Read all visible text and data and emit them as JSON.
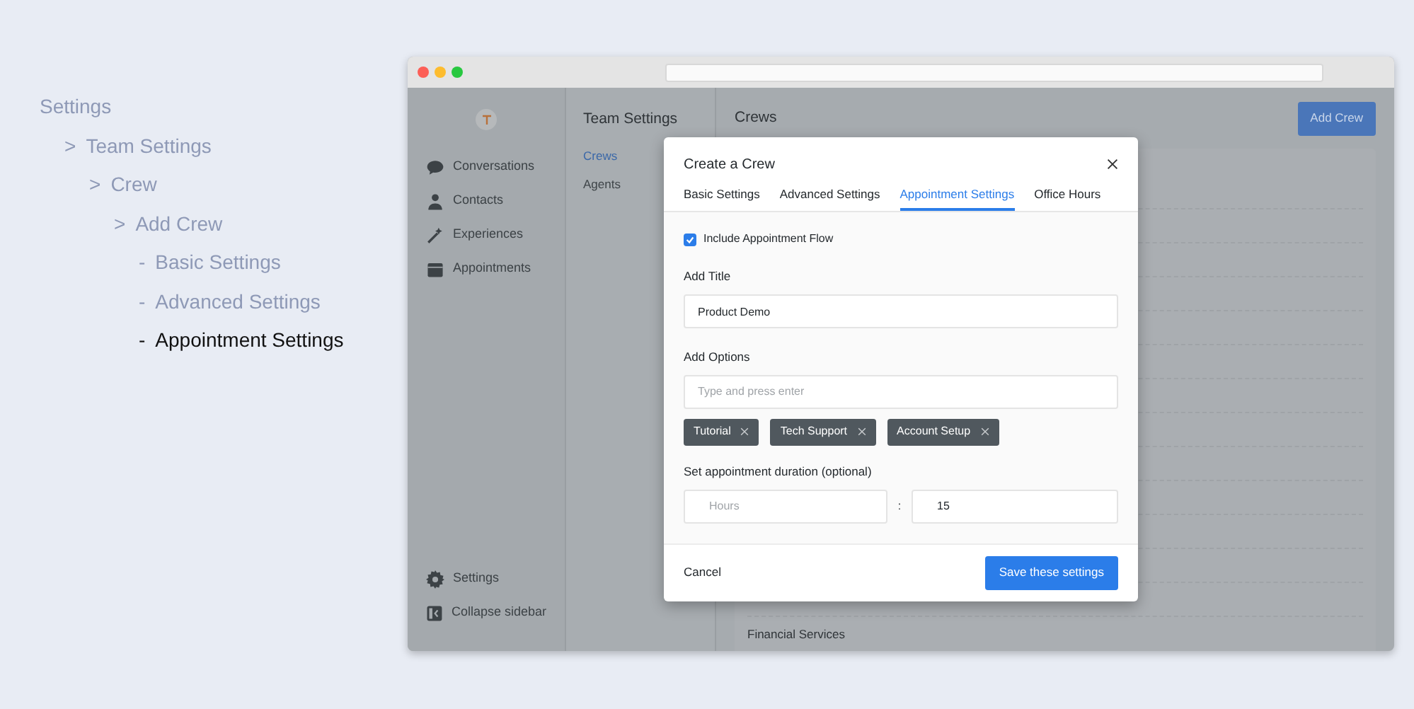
{
  "outline": [
    {
      "label": "Settings",
      "selected": false,
      "children": [
        {
          "prefix": ">",
          "label": "Team Settings",
          "selected": false,
          "children": [
            {
              "prefix": ">",
              "label": "Crew",
              "selected": false,
              "children": [
                {
                  "prefix": ">",
                  "label": "Add Crew",
                  "selected": false,
                  "children": [
                    {
                      "prefix": "-",
                      "label": "Basic Settings",
                      "selected": false
                    },
                    {
                      "prefix": "-",
                      "label": "Advanced Settings",
                      "selected": false
                    },
                    {
                      "prefix": "-",
                      "label": "Appointment Settings",
                      "selected": true
                    }
                  ]
                }
              ]
            }
          ]
        }
      ]
    }
  ],
  "sidebar": {
    "items": [
      {
        "label": "Conversations"
      },
      {
        "label": "Contacts"
      },
      {
        "label": "Experiences"
      },
      {
        "label": "Appointments"
      }
    ],
    "bottom_items": [
      {
        "label": "Settings"
      },
      {
        "label": "Collapse sidebar"
      }
    ]
  },
  "team_panel": {
    "title": "Team Settings",
    "items": [
      {
        "label": "Crews",
        "selected": true
      },
      {
        "label": "Agents",
        "selected": false
      }
    ]
  },
  "main": {
    "title": "Crews",
    "add_button": "Add Crew",
    "rows": [
      "Financial Services"
    ]
  },
  "modal": {
    "title": "Create a Crew",
    "tabs": [
      {
        "label": "Basic Settings",
        "selected": false
      },
      {
        "label": "Advanced Settings",
        "selected": false
      },
      {
        "label": "Appointment Settings",
        "selected": true
      },
      {
        "label": "Office Hours",
        "selected": false
      }
    ],
    "include_flow": {
      "label": "Include Appointment Flow",
      "checked": true
    },
    "title_field": {
      "label": "Add Title",
      "value": "Product Demo"
    },
    "options_field": {
      "label": "Add Options",
      "placeholder": "Type and press enter",
      "tags": [
        "Tutorial",
        "Tech Support",
        "Account Setup"
      ]
    },
    "duration": {
      "label": "Set appointment duration (optional)",
      "hours_placeholder": "Hours",
      "separator": ":",
      "minutes_value": "15"
    },
    "cancel": "Cancel",
    "save": "Save these settings"
  }
}
